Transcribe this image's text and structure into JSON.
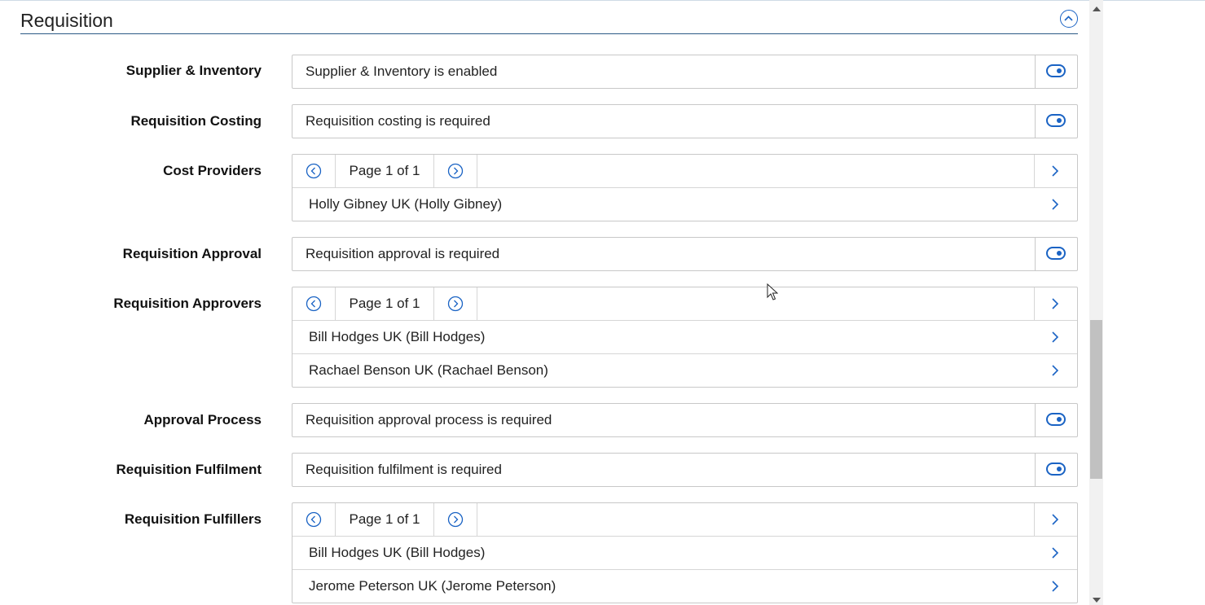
{
  "section": {
    "title": "Requisition",
    "collapse_icon": "chevron-up-circle-icon"
  },
  "rows": {
    "supplier_inventory": {
      "label": "Supplier & Inventory",
      "value": "Supplier & Inventory is enabled",
      "toggle_on": true
    },
    "requisition_costing": {
      "label": "Requisition Costing",
      "value": "Requisition costing is required",
      "toggle_on": true
    },
    "cost_providers": {
      "label": "Cost Providers",
      "pager": "Page 1 of 1",
      "items": [
        "Holly Gibney UK (Holly Gibney)"
      ]
    },
    "requisition_approval": {
      "label": "Requisition Approval",
      "value": "Requisition approval is required",
      "toggle_on": true
    },
    "requisition_approvers": {
      "label": "Requisition Approvers",
      "pager": "Page 1 of 1",
      "items": [
        "Bill Hodges UK (Bill Hodges)",
        "Rachael Benson UK (Rachael Benson)"
      ]
    },
    "approval_process": {
      "label": "Approval Process",
      "value": "Requisition approval process is required",
      "toggle_on": true
    },
    "requisition_fulfilment": {
      "label": "Requisition Fulfilment",
      "value": "Requisition fulfilment is required",
      "toggle_on": true
    },
    "requisition_fulfillers": {
      "label": "Requisition Fulfillers",
      "pager": "Page 1 of 1",
      "items": [
        "Bill Hodges UK (Bill Hodges)",
        "Jerome Peterson UK (Jerome Peterson)"
      ]
    }
  },
  "colors": {
    "accent": "#1a63c4",
    "border": "#c8c8c8",
    "header_rule": "#2c5a86"
  }
}
